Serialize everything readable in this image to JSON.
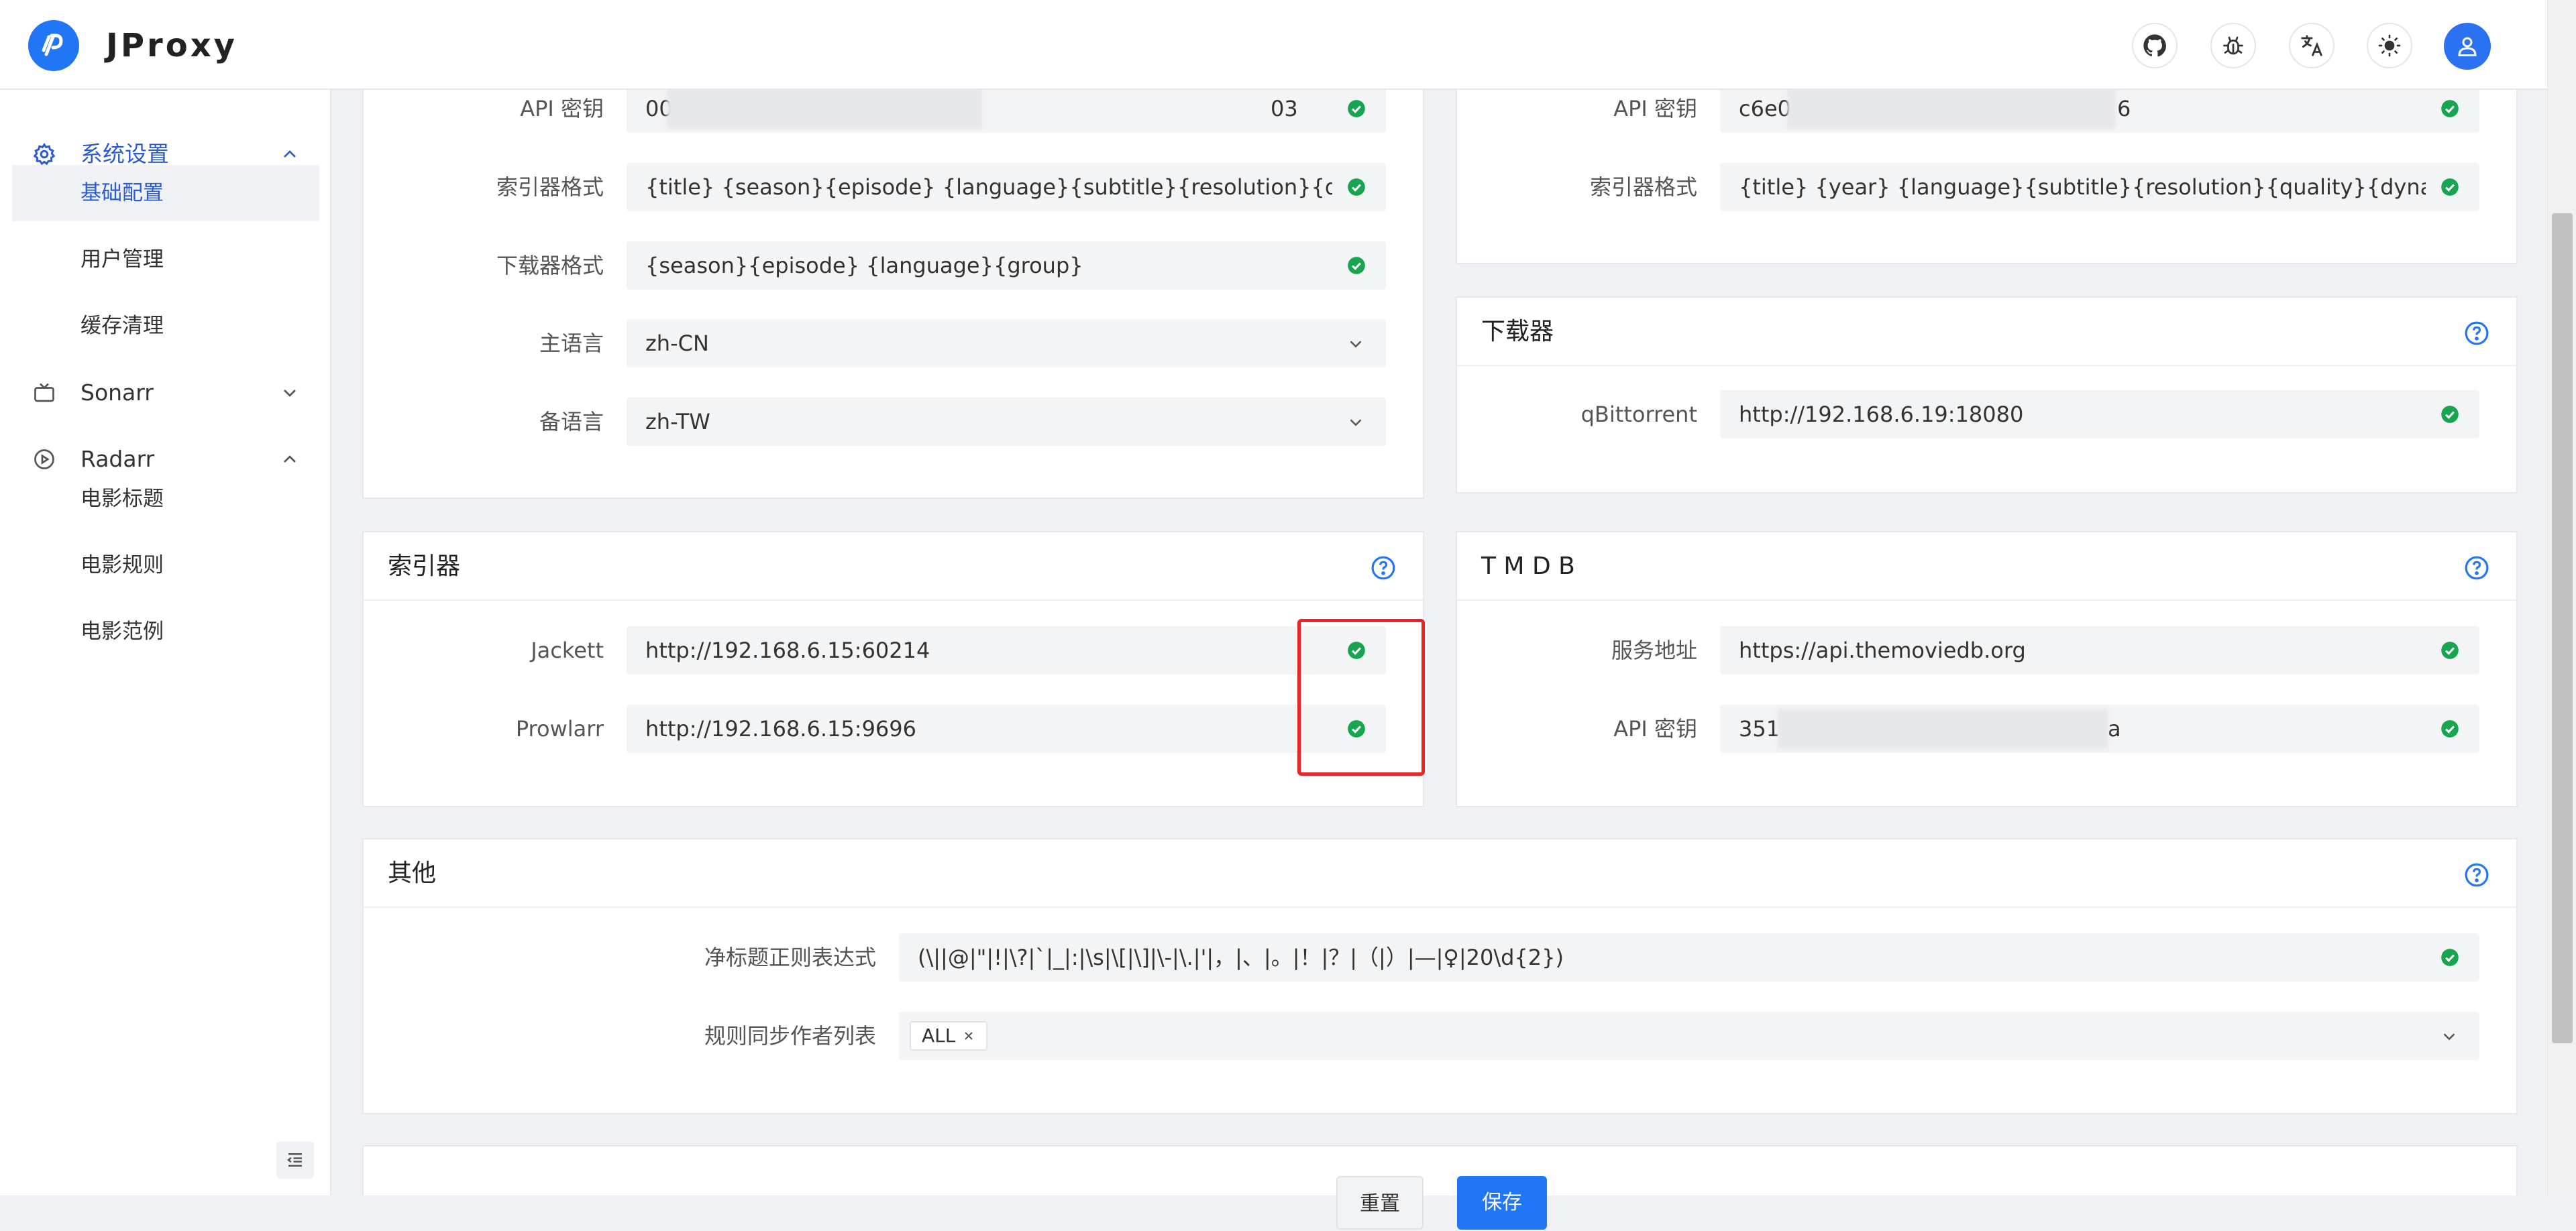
{
  "app": {
    "title": "JProxy"
  },
  "sidebar": {
    "groups": [
      {
        "label": "系统设置",
        "items": [
          "基础配置",
          "用户管理",
          "缓存清理"
        ]
      },
      {
        "label": "Sonarr",
        "items": []
      },
      {
        "label": "Radarr",
        "items": [
          "电影标题",
          "电影规则",
          "电影范例"
        ]
      }
    ]
  },
  "sonarr_card": {
    "rows": [
      {
        "label": "API 密钥",
        "value": "00",
        "value_end": "03"
      },
      {
        "label": "索引器格式",
        "value": "{title} {season}{episode} {language}{subtitle}{resolution}{quality}{dynamic_range}"
      },
      {
        "label": "下载器格式",
        "value": "{season}{episode} {language}{group}"
      },
      {
        "label": "主语言",
        "value": "zh-CN"
      },
      {
        "label": "备语言",
        "value": "zh-TW"
      }
    ]
  },
  "radarr_card": {
    "rows": [
      {
        "label": "API 密钥",
        "value": "c6e0",
        "value_end": "6"
      },
      {
        "label": "索引器格式",
        "value": "{title} {year} {language}{subtitle}{resolution}{quality}{dynamic_range}"
      }
    ]
  },
  "downloader_card": {
    "title": "下载器",
    "rows": [
      {
        "label": "qBittorrent",
        "value": "http://192.168.6.19:18080"
      }
    ]
  },
  "indexer_card": {
    "title": "索引器",
    "rows": [
      {
        "label": "Jackett",
        "value": "http://192.168.6.15:60214"
      },
      {
        "label": "Prowlarr",
        "value": "http://192.168.6.15:9696"
      }
    ]
  },
  "tmdb_card": {
    "title": "T M D B",
    "rows": [
      {
        "label": "服务地址",
        "value": "https://api.themoviedb.org"
      },
      {
        "label": "API 密钥",
        "value": "351",
        "value_end": "a"
      }
    ]
  },
  "other_card": {
    "title": "其他",
    "rows": [
      {
        "label": "净标题正则表达式",
        "value": "(\\||@|\"|!|\\?|`|_|:|\\s|\\[|\\]|\\-|\\.|'|，|、|。|！|？|（|）|—|♀|20\\d{2})"
      },
      {
        "label": "规则同步作者列表",
        "tag": "ALL"
      }
    ]
  },
  "actions": {
    "reset": "重置",
    "save": "保存"
  },
  "colors": {
    "accent": "#2176f5",
    "success": "#18a550",
    "highlight": "#e8262a"
  }
}
